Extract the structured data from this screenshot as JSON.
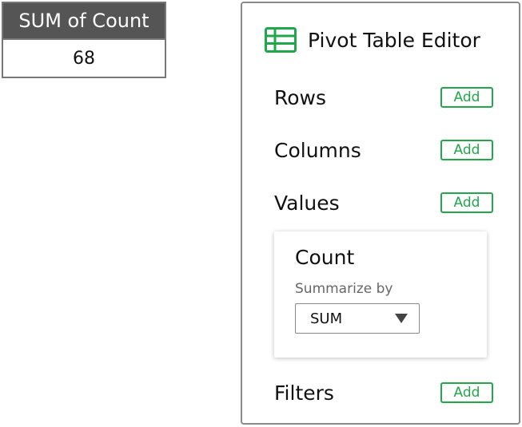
{
  "pivot_table": {
    "header": "SUM of Count",
    "value": "68"
  },
  "editor": {
    "title": "Pivot Table Editor",
    "icon": "spreadsheet-icon",
    "sections": {
      "rows": {
        "label": "Rows",
        "add_label": "Add"
      },
      "columns": {
        "label": "Columns",
        "add_label": "Add"
      },
      "values": {
        "label": "Values",
        "add_label": "Add"
      },
      "filters": {
        "label": "Filters",
        "add_label": "Add"
      }
    },
    "value_card": {
      "field_name": "Count",
      "summarize_label": "Summarize by",
      "summarize_value": "SUM"
    }
  },
  "colors": {
    "accent_green": "#22a64b",
    "header_gray": "#555555",
    "border_gray": "#8a8a8a"
  }
}
